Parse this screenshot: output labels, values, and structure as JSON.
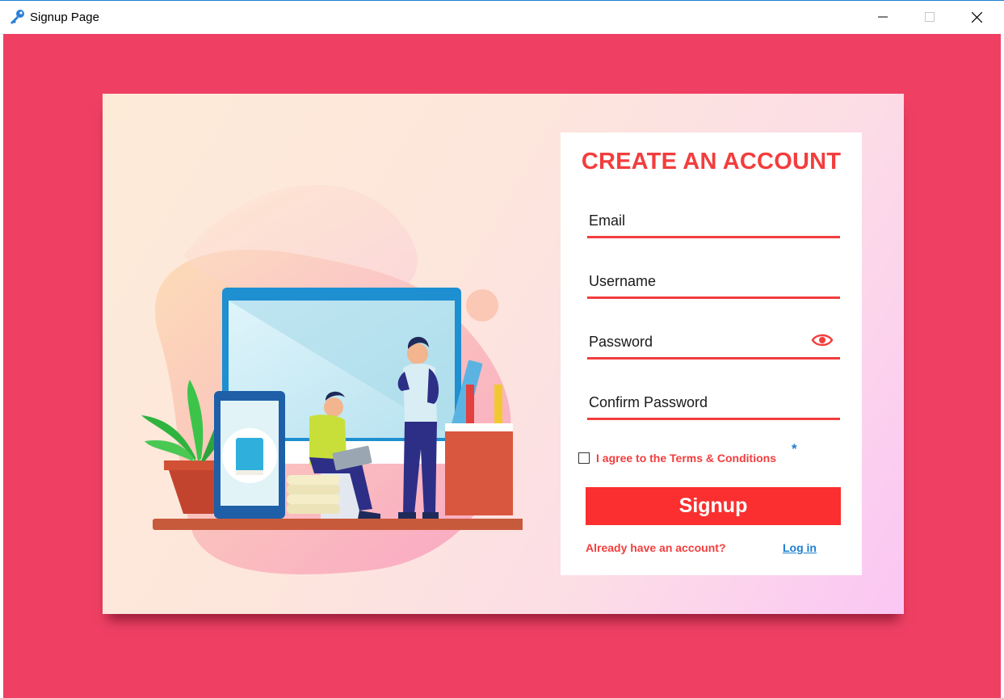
{
  "window": {
    "title": "Signup Page",
    "icon": "key-icon",
    "controls": [
      "minimize-icon",
      "maximize-icon",
      "close-icon"
    ]
  },
  "colors": {
    "background": "#ef4064",
    "accent": "#f33d3d",
    "button": "#fb2f2f",
    "link": "#1e7fd0"
  },
  "form": {
    "heading": "CREATE AN ACCOUNT",
    "email_placeholder": "Email",
    "username_placeholder": "Username",
    "password_placeholder": "Password",
    "confirm_password_placeholder": "Confirm Password",
    "password_toggle_icon": "eye-icon",
    "agree_label": "I agree to the Terms & Conditions",
    "required_marker": "*",
    "signup_label": "Signup",
    "already_label": "Already have an account?",
    "login_label": "Log in"
  }
}
